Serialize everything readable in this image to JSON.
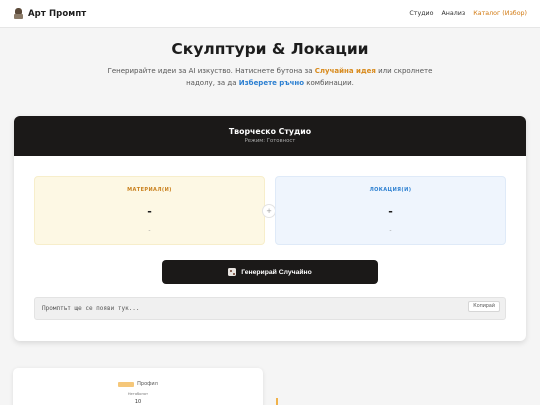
{
  "header": {
    "brand": "Арт Промпт",
    "nav": [
      "Студио",
      "Анализ",
      "Каталог (Избор)"
    ]
  },
  "hero": {
    "title": "Скулптури & Локации",
    "sub_1": "Генерирайте идеи за AI изкуство. Натиснете бутона за ",
    "sub_hl1": "Случайна идея",
    "sub_2": " или скролнете надолу, за да ",
    "sub_hl2": "Изберете ръчно",
    "sub_3": " комбинации."
  },
  "studio": {
    "title": "Творческо Студио",
    "mode": "Режим: Готовност",
    "material": {
      "label": "МАТЕРИАЛ(И)",
      "value": "-",
      "sub": "-"
    },
    "location": {
      "label": "ЛОКАЦИЯ(И)",
      "value": "-",
      "sub": "-"
    },
    "plus": "+",
    "generate_label": "Генерирай Случайно",
    "prompt_placeholder": "Промптът ще се появи тук...",
    "copy_label": "Копирай"
  },
  "lower": {
    "profile_label": "Профил",
    "small_text": "Нетабонот",
    "number": "10"
  },
  "colors": {
    "accent_orange": "#d88a1c",
    "accent_blue": "#2b7fd1",
    "dark": "#1b1918"
  },
  "icons": {
    "brand": "bust-sculpture-icon",
    "generate": "dice-icon"
  }
}
